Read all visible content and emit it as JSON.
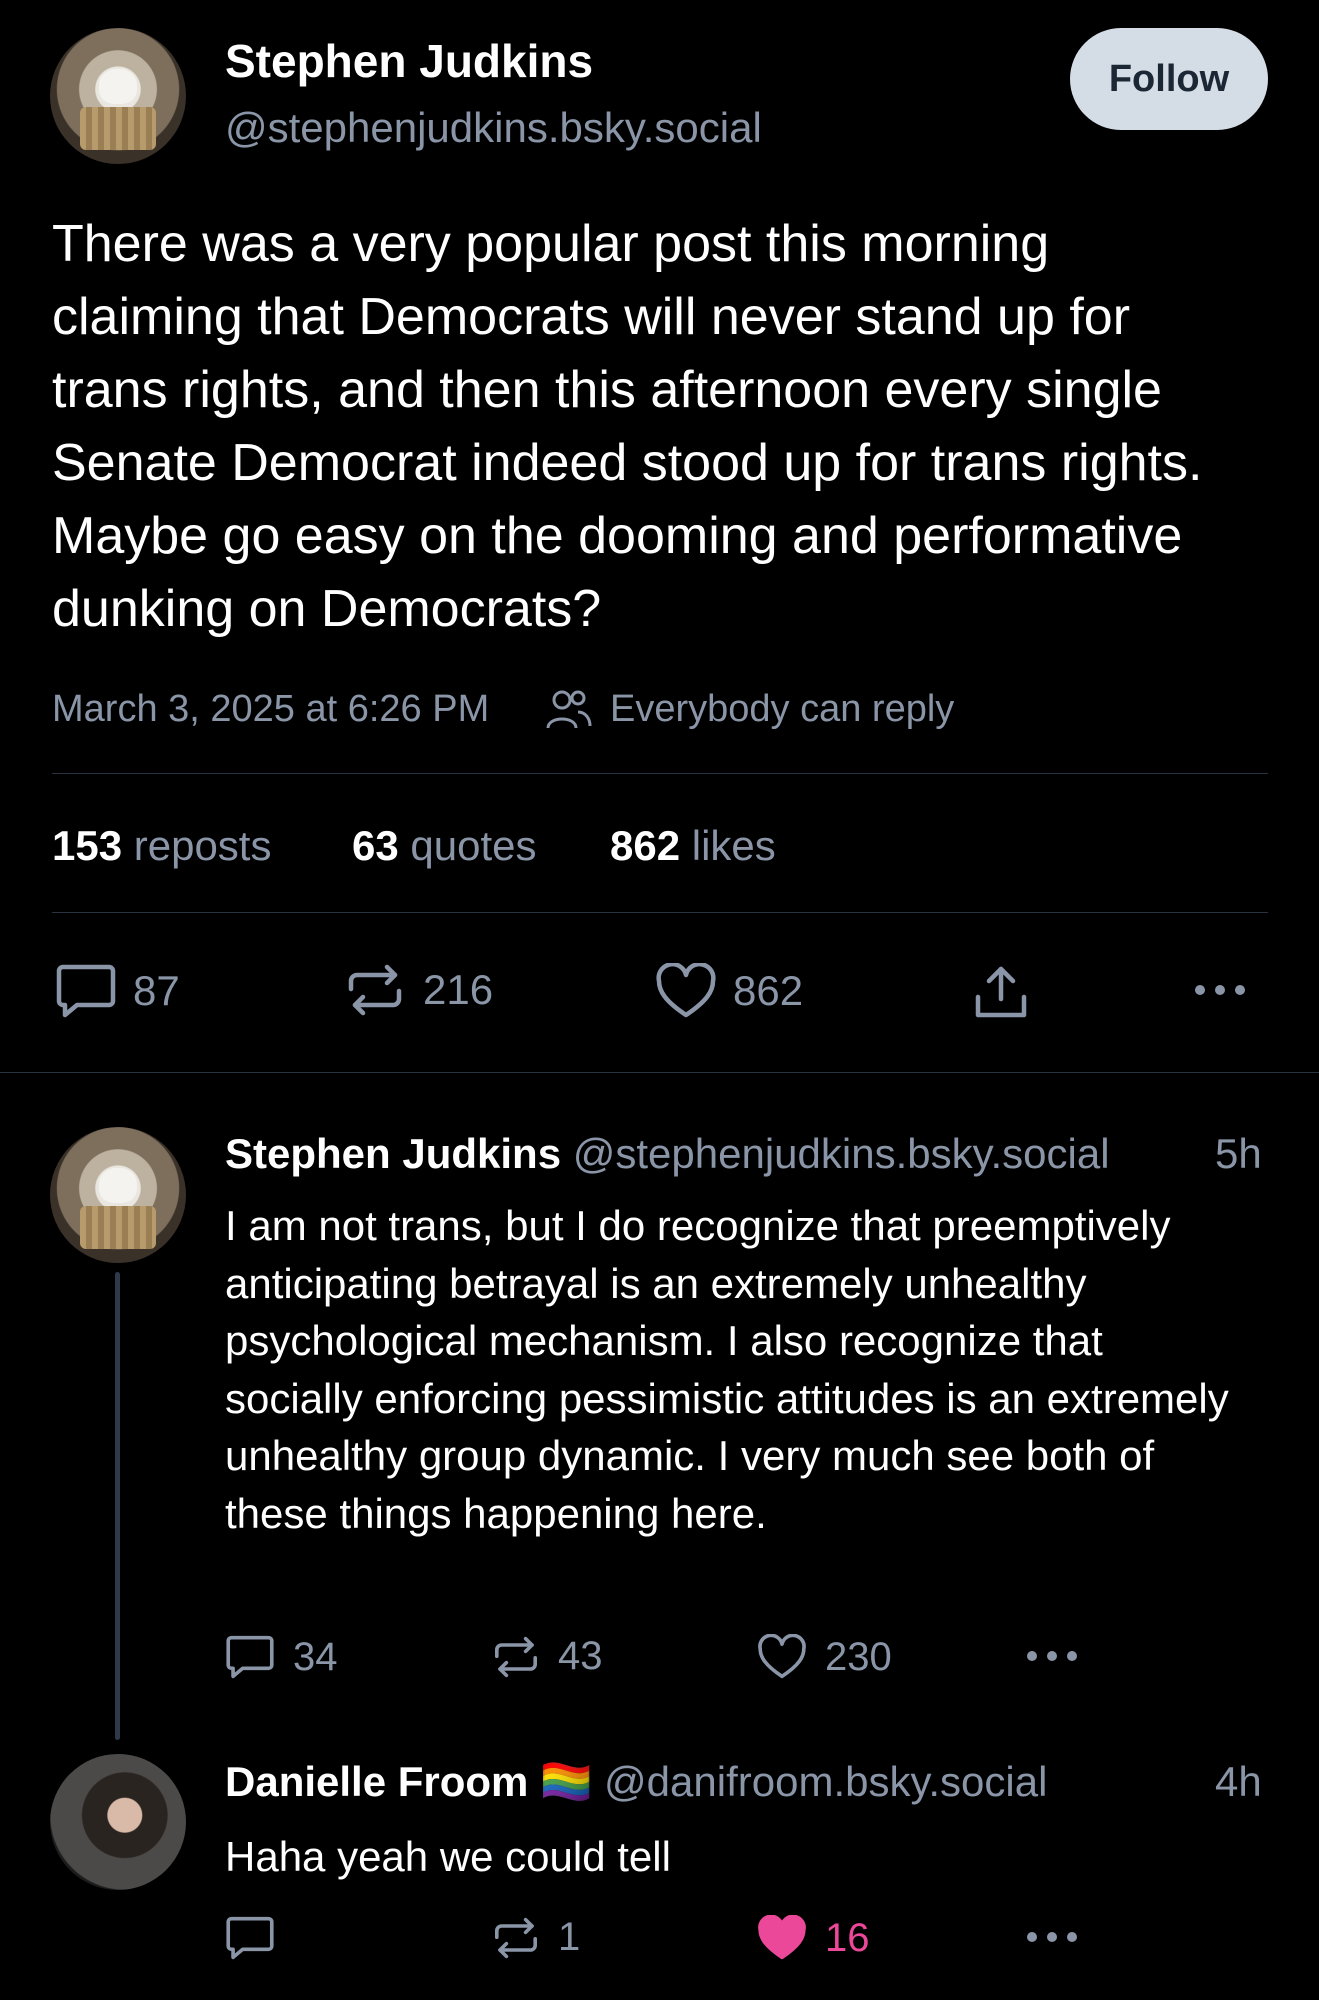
{
  "main_post": {
    "author_name": "Stephen Judkins",
    "author_handle": "@stephenjudkins.bsky.social",
    "follow_label": "Follow",
    "text": "There was a very popular post this morning claiming that Democrats will never stand up for trans rights, and then this afternoon every single Senate Democrat indeed stood up for trans rights. Maybe go easy on the dooming and performative dunking on Democrats?",
    "timestamp": "March 3, 2025 at 6:26 PM",
    "reply_setting": "Everybody can reply",
    "stats": {
      "reposts_count": "153",
      "reposts_label": "reposts",
      "quotes_count": "63",
      "quotes_label": "quotes",
      "likes_count": "862",
      "likes_label": "likes"
    },
    "actions": {
      "replies": "87",
      "reposts": "216",
      "likes": "862"
    }
  },
  "replies": [
    {
      "author_name": "Stephen Judkins",
      "author_handle": "@stephenjudkins.bsky.social",
      "time": "5h",
      "text": "I am not trans, but I do recognize that preemptively anticipating betrayal is an extremely unhealthy psychological mechanism. I also recognize that socially enforcing pessimistic attitudes is an extremely unhealthy group dynamic. I very much see both of these things happening here.",
      "replies": "34",
      "reposts": "43",
      "likes": "230"
    },
    {
      "author_name": "Danielle Froom",
      "flag": "🏳️‍🌈",
      "author_handle": "@danifroom.bsky.social",
      "time": "4h",
      "text": "Haha yeah we could tell",
      "replies": "",
      "reposts": "1",
      "likes": "16"
    }
  ],
  "colors": {
    "background": "#000000",
    "muted": "#8a96a8",
    "like_active": "#ec4899",
    "follow_bg": "#d4dce6"
  }
}
